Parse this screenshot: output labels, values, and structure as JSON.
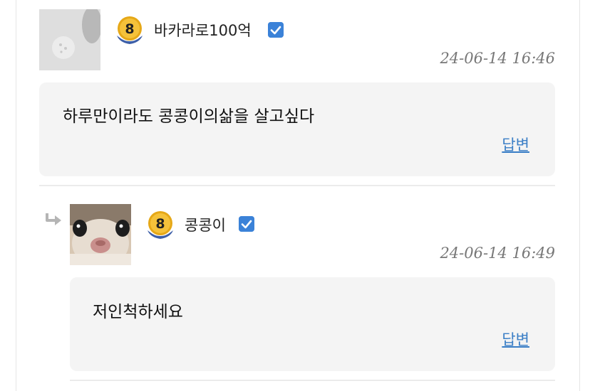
{
  "comments": [
    {
      "username": "바카라로100억",
      "level": "8",
      "timestamp": "24-06-14 16:46",
      "text": "하루만이라도 콩콩이의삶을 살고싶다",
      "reply_label": "답변",
      "avatar": "default-avatar",
      "verified": true
    },
    {
      "username": "콩콩이",
      "level": "8",
      "timestamp": "24-06-14 16:49",
      "text": "저인척하세요",
      "reply_label": "답변",
      "avatar": "cat-avatar",
      "verified": true,
      "is_reply": true
    }
  ],
  "colors": {
    "bubble": "#f4f4f4",
    "link": "#3a7ec6",
    "verified": "#3b82d8",
    "badge_gold": "#e6a817"
  },
  "icons": [
    "level-badge-icon",
    "verified-check-icon",
    "reply-arrow-icon"
  ]
}
